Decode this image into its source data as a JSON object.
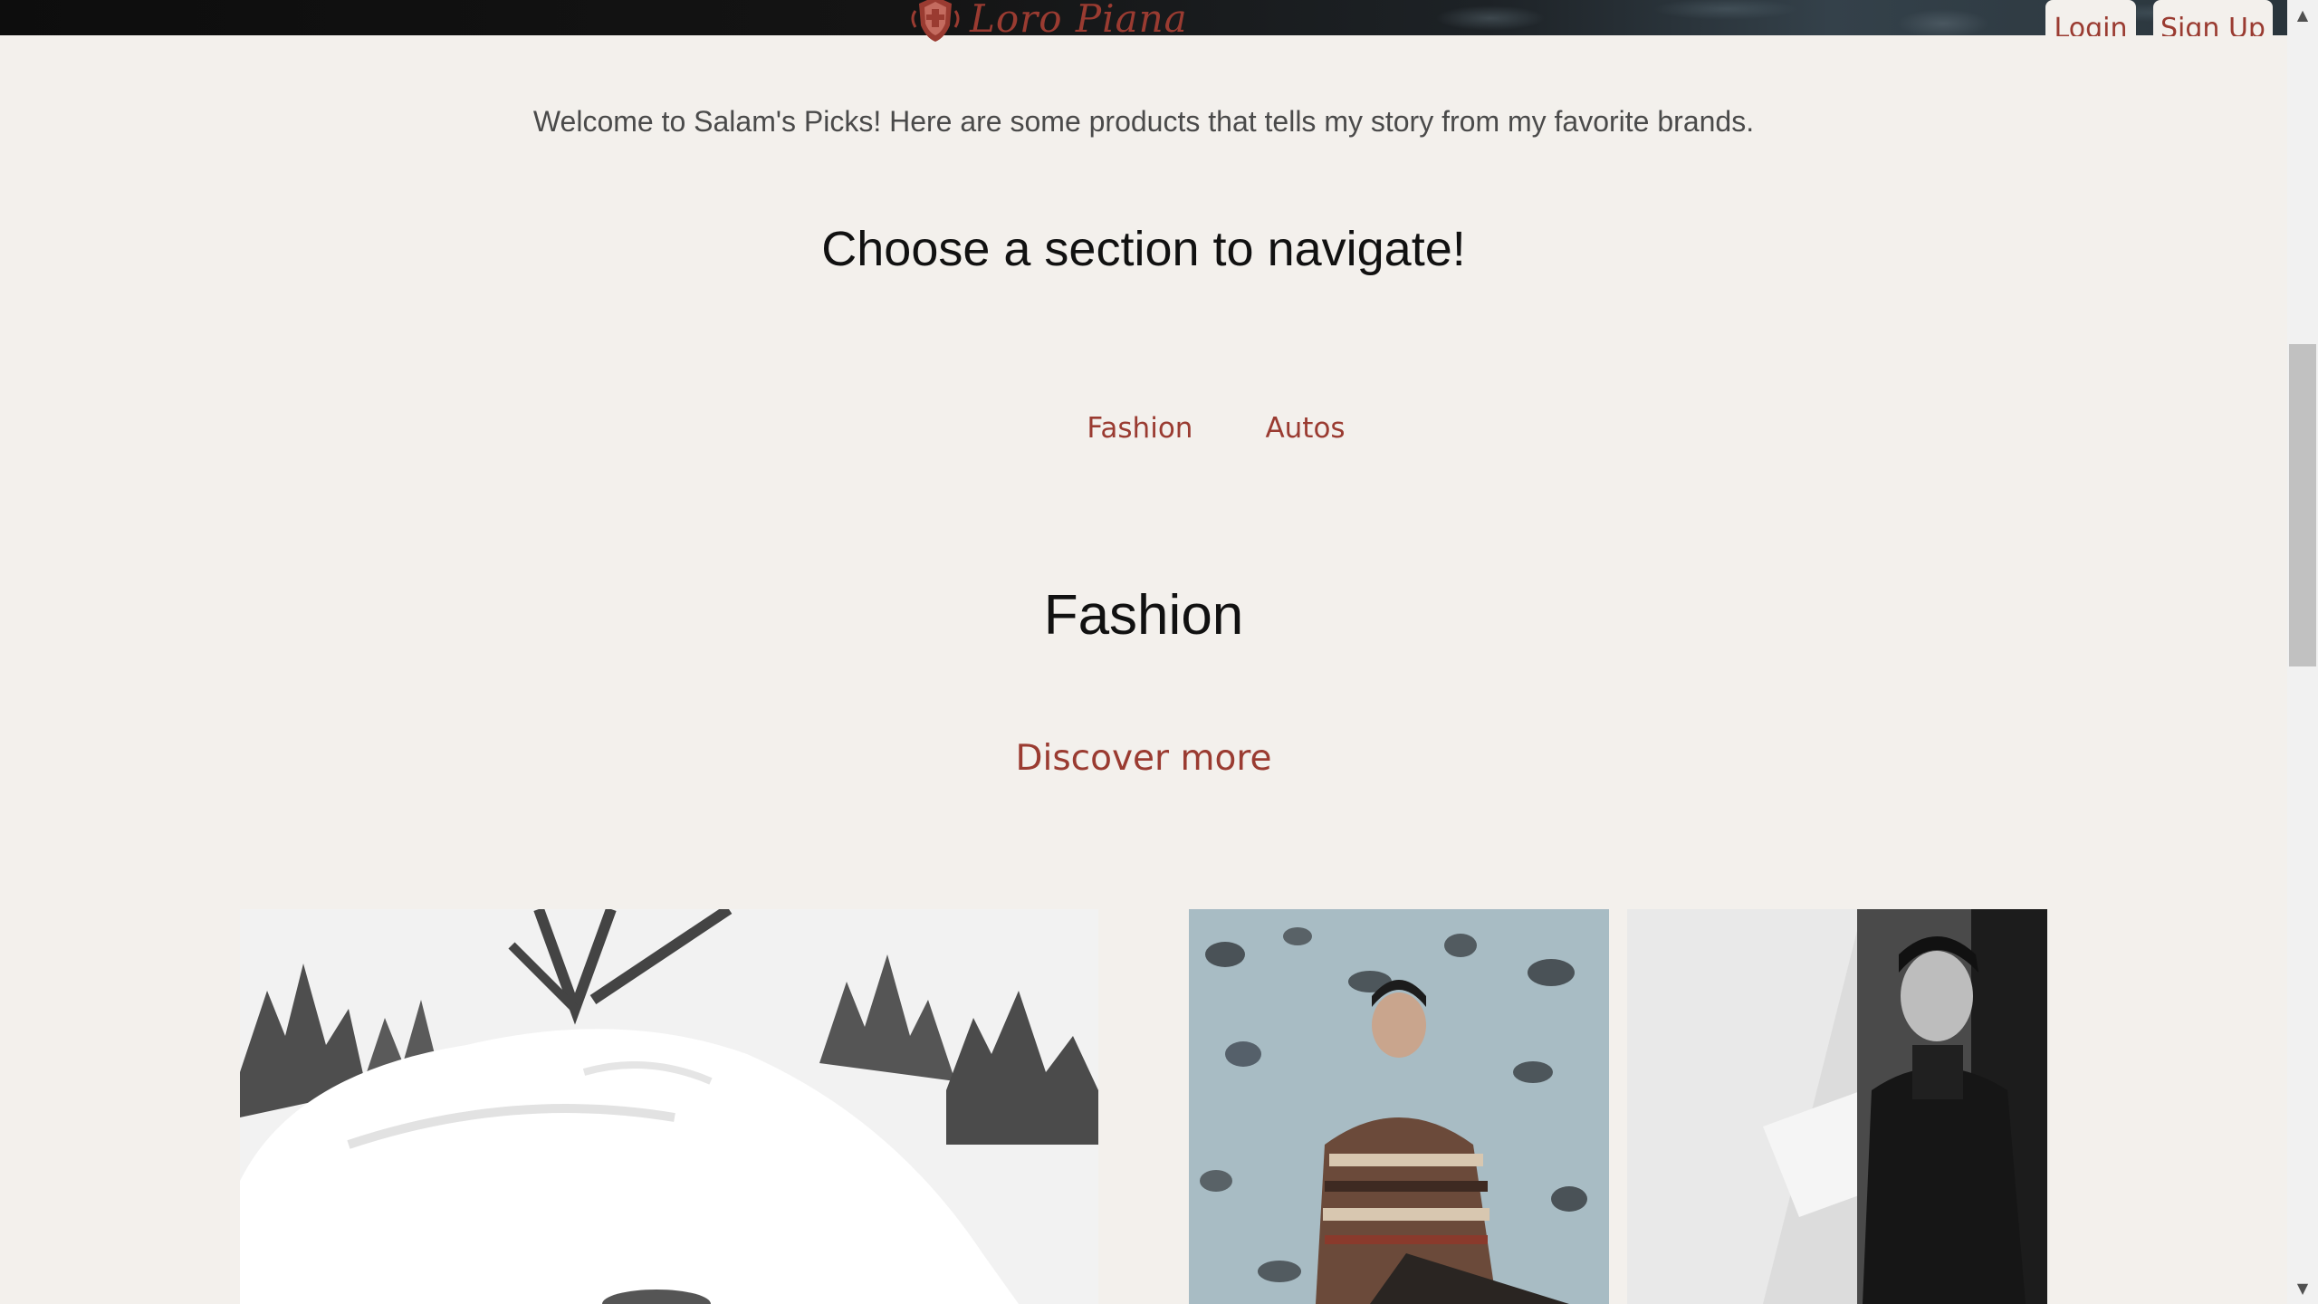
{
  "header": {
    "brand": "Loro Piana",
    "auth": {
      "login_label": "Login",
      "signup_label": "Sign Up"
    }
  },
  "intro": {
    "welcome": "Welcome to Salam's Picks! Here are some products that tells my story from my favorite brands.",
    "navigate_heading": "Choose a section to navigate!"
  },
  "section_nav": {
    "items": [
      {
        "label": "Fashion"
      },
      {
        "label": "Autos"
      }
    ]
  },
  "fashion": {
    "title": "Fashion",
    "discover_label": "Discover more",
    "gallery": [
      {
        "name": "snow-scene-image"
      },
      {
        "name": "patterned-sweater-image"
      },
      {
        "name": "dark-coat-image"
      }
    ]
  },
  "colors": {
    "accent": "#9a3b31",
    "background": "#f3f0ec",
    "heading": "#111111",
    "body_text": "#4a4a4a"
  },
  "icons": {
    "crest": "crest-icon",
    "scroll_up": "chevron-up-icon",
    "scroll_down": "chevron-down-icon"
  }
}
